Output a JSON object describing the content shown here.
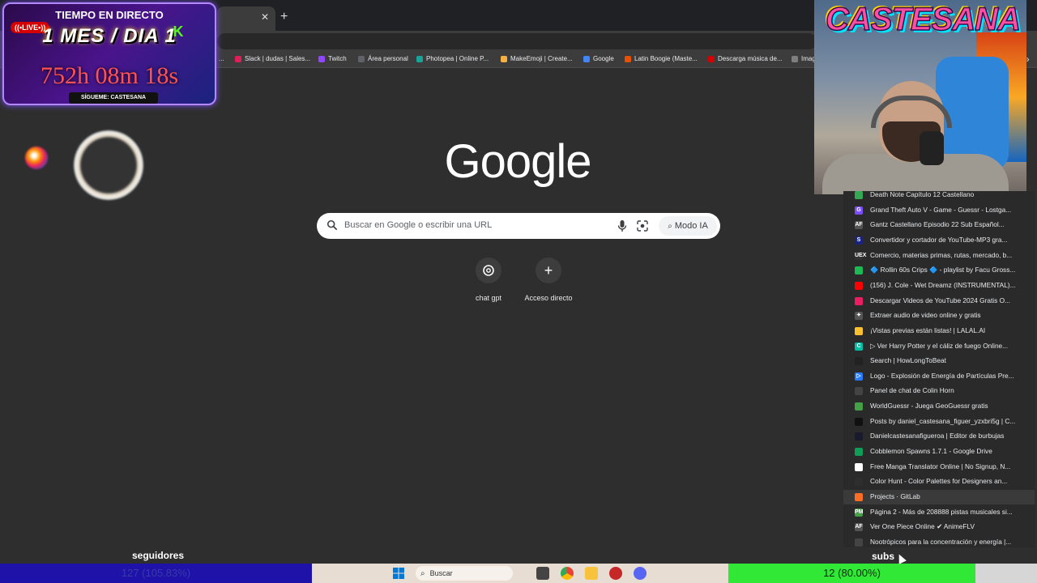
{
  "browser": {
    "bookmarks": [
      {
        "label": "...",
        "icon": "ellipsis-icon",
        "color": "#5f6368"
      },
      {
        "label": "Slack | dudas | Sales...",
        "icon": "slack-icon",
        "color": "#e01e5a"
      },
      {
        "label": "Twitch",
        "icon": "twitch-icon",
        "color": "#9146ff"
      },
      {
        "label": "Área personal",
        "icon": "key-icon",
        "color": "#5f6368"
      },
      {
        "label": "Photopea | Online P...",
        "icon": "photopea-icon",
        "color": "#18a497"
      },
      {
        "label": "MakeEmoji | Create...",
        "icon": "cat-icon",
        "color": "#f5b041"
      },
      {
        "label": "Google",
        "icon": "google-icon",
        "color": "#4285f4"
      },
      {
        "label": "Latin Boogie (Maste...",
        "icon": "music-icon",
        "color": "#e65100"
      },
      {
        "label": "Descarga música de...",
        "icon": "download-icon",
        "color": "#d50000"
      },
      {
        "label": "Imag",
        "icon": "image-icon",
        "color": "#7f7f7f"
      }
    ]
  },
  "overlay": {
    "timer_title": "TIEMPO EN DIRECTO",
    "live_badge": "((•LIVE•))",
    "mes_dia": "1 MES / DIA 1",
    "kick_letter": "K",
    "elapsed": "752h 08m 18s",
    "follow_text": "SÍGUEME: CASTESANA",
    "brand": "CASTESANA",
    "followers_label": "seguidores",
    "followers_value": "127 (105.83%)",
    "followers_progress": 1.0,
    "subs_label": "subs",
    "subs_value": "12 (80.00%)",
    "subs_progress": 0.8
  },
  "ntp": {
    "logo": "Google",
    "search_placeholder": "Buscar en Google o escribir una URL",
    "ai_mode_label": "Modo IA",
    "shortcuts": [
      {
        "label": "chat gpt",
        "icon": "chatgpt-icon"
      },
      {
        "label": "Acceso directo",
        "icon": "plus-icon"
      }
    ]
  },
  "history": [
    {
      "title": "Death Note Capítulo 12 Castellano",
      "icon": "green-square-icon",
      "color": "#34a853",
      "glyph": ""
    },
    {
      "title": "Grand Theft Auto V - Game - Guessr - Lostga...",
      "icon": "g-logo-icon",
      "color": "#7c4dff",
      "glyph": "G"
    },
    {
      "title": "Gantz Castellano Episodio 22 Sub Español...",
      "icon": "af-icon",
      "color": "#555555",
      "glyph": "AF"
    },
    {
      "title": "Convertidor y cortador de YouTube-MP3 gra...",
      "icon": "s-icon",
      "color": "#1a237e",
      "glyph": "S"
    },
    {
      "title": "Comercio, materias primas, rutas, mercado, b...",
      "icon": "uex-icon",
      "color": "#333333",
      "glyph": "UEX"
    },
    {
      "title": "🔷 Rollin 60s Crips 🔷 - playlist by Facu Gross...",
      "icon": "spotify-icon",
      "color": "#1db954",
      "glyph": ""
    },
    {
      "title": "(156) J. Cole - Wet Dreamz (INSTRUMENTAL)...",
      "icon": "youtube-icon",
      "color": "#ff0000",
      "glyph": ""
    },
    {
      "title": "Descargar Videos de YouTube 2024 Gratis O...",
      "icon": "download-icon",
      "color": "#e91e63",
      "glyph": ""
    },
    {
      "title": "Extraer audio de video online y gratis",
      "icon": "dots-icon",
      "color": "#555555",
      "glyph": "✦"
    },
    {
      "title": "¡Vistas previas están listas! | LALAL.AI",
      "icon": "smile-icon",
      "color": "#fbc02d",
      "glyph": ""
    },
    {
      "title": "▷ Ver Harry Potter y el cáliz de fuego Online...",
      "icon": "c-icon",
      "color": "#00bfa5",
      "glyph": "C"
    },
    {
      "title": "Search | HowLongToBeat",
      "icon": "hltb-icon",
      "color": "#222222",
      "glyph": ""
    },
    {
      "title": "Logo - Explosión de Energía de Partículas Pre...",
      "icon": "play-icon",
      "color": "#2979ff",
      "glyph": "▷"
    },
    {
      "title": "Panel de chat de Colin Horn",
      "icon": "window-icon",
      "color": "#444444",
      "glyph": ""
    },
    {
      "title": "WorldGuessr - Juega GeoGuessr gratis",
      "icon": "globe-icon",
      "color": "#43a047",
      "glyph": ""
    },
    {
      "title": "Posts by daniel_castesana_figuer_yzxbri5g | C...",
      "icon": "dark-icon",
      "color": "#111111",
      "glyph": ""
    },
    {
      "title": "Danielcastesanafigueroa | Editor de burbujas",
      "icon": "dark-icon",
      "color": "#1a1a2e",
      "glyph": ""
    },
    {
      "title": "Cobblemon Spawns 1.7.1 - Google Drive",
      "icon": "sheets-icon",
      "color": "#0f9d58",
      "glyph": ""
    },
    {
      "title": "Free Manga Translator Online | No Signup, N...",
      "icon": "manga-icon",
      "color": "#ffffff",
      "glyph": ""
    },
    {
      "title": "Color Hunt - Color Palettes for Designers an...",
      "icon": "heart-icon",
      "color": "#2e2e2e",
      "glyph": ""
    },
    {
      "title": "Projects · GitLab",
      "icon": "gitlab-icon",
      "color": "#fc6d26",
      "glyph": ""
    },
    {
      "title": "Página 2 - Más de 208888 pistas musicales si...",
      "icon": "pm-icon",
      "color": "#43a047",
      "glyph": "PM"
    },
    {
      "title": "Ver One Piece Online ✔ AnimeFLV",
      "icon": "af-icon",
      "color": "#555555",
      "glyph": "AF"
    },
    {
      "title": "Nootrópicos para la concentración y energía |...",
      "icon": "doc-icon",
      "color": "#444444",
      "glyph": ""
    }
  ],
  "taskbar": {
    "search_label": "Buscar",
    "icons": [
      "windows-icon",
      "task-view-icon",
      "chrome-icon",
      "file-explorer-icon",
      "app-icon",
      "discord-icon"
    ]
  }
}
